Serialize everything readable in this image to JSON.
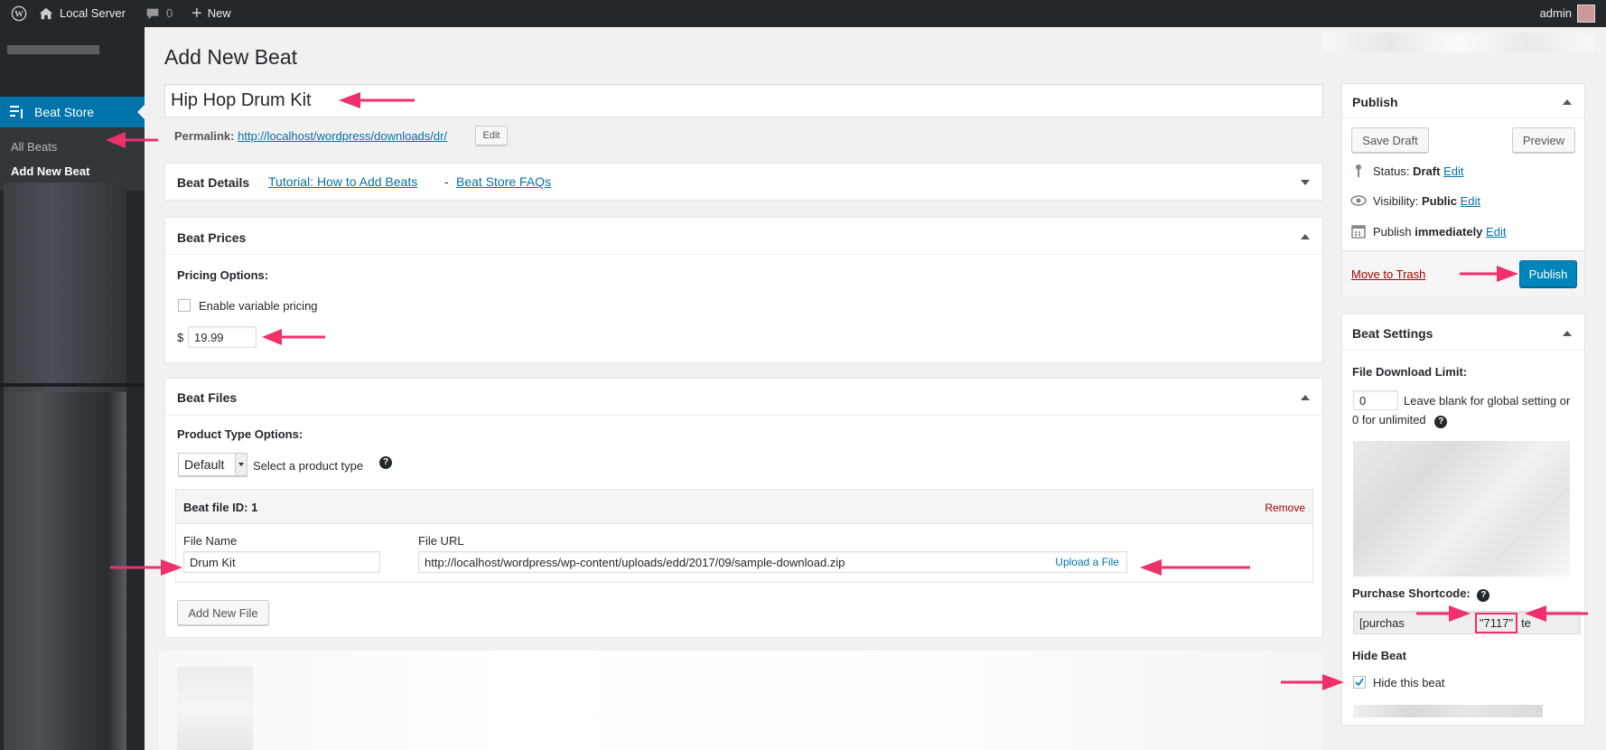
{
  "admin_bar": {
    "site_name": "Local Server",
    "comments_count": "0",
    "new_label": "New",
    "user": "admin"
  },
  "sidebar": {
    "active_menu": "Beat Store",
    "submenu": [
      {
        "label": "All Beats"
      },
      {
        "label": "Add New Beat"
      }
    ]
  },
  "page": {
    "title": "Add New Beat",
    "post_title": "Hip Hop Drum Kit",
    "permalink_label": "Permalink:",
    "permalink_url": "http://localhost/wordpress/downloads/dr/",
    "permalink_edit": "Edit"
  },
  "beat_details": {
    "title": "Beat Details",
    "tutorial_link": "Tutorial: How to Add Beats",
    "separator": "-",
    "faq_link": "Beat Store FAQs"
  },
  "beat_prices": {
    "title": "Beat Prices",
    "pricing_options_label": "Pricing Options:",
    "variable_pricing_label": "Enable variable pricing",
    "currency": "$",
    "price": "19.99"
  },
  "beat_files": {
    "title": "Beat Files",
    "product_type_label": "Product Type Options:",
    "product_type_value": "Default",
    "product_type_hint": "Select a product type",
    "file_row_title": "Beat file ID: 1",
    "remove_label": "Remove",
    "file_name_header": "File Name",
    "file_url_header": "File URL",
    "file_name_value": "Drum Kit",
    "file_url_value": "http://localhost/wordpress/wp-content/uploads/edd/2017/09/sample-download.zip",
    "upload_label": "Upload a File",
    "add_file_button": "Add New File"
  },
  "publish": {
    "title": "Publish",
    "save_draft": "Save Draft",
    "preview": "Preview",
    "status_label": "Status:",
    "status_value": "Draft",
    "visibility_label": "Visibility:",
    "visibility_value": "Public",
    "publish_label": "Publish",
    "publish_time": "immediately",
    "edit_link": "Edit",
    "trash": "Move to Trash",
    "publish_button": "Publish"
  },
  "beat_settings": {
    "title": "Beat Settings",
    "download_limit_label": "File Download Limit:",
    "download_limit_value": "0",
    "download_limit_hint_1": "Leave blank for global setting or",
    "download_limit_hint_2": "0 for unlimited",
    "shortcode_label": "Purchase Shortcode:",
    "shortcode_start": "[purchas",
    "shortcode_id": "\"7117\"",
    "shortcode_end": "te",
    "hide_label": "Hide Beat",
    "hide_checkbox_label": "Hide this beat",
    "hide_checked": true
  },
  "colors": {
    "admin_bar": "#23282d",
    "accent": "#0073aa",
    "arrow": "#f0306a",
    "trash": "#a00"
  }
}
